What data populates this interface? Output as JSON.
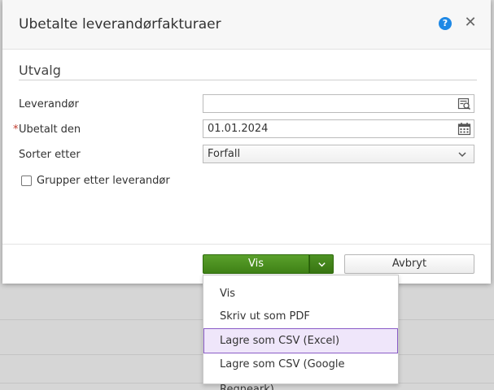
{
  "dialog": {
    "title": "Ubetalte leverandørfakturaer",
    "help_icon": "question-circle-icon",
    "close_glyph": "✕"
  },
  "section": {
    "title": "Utvalg"
  },
  "fields": {
    "supplier": {
      "label": "Leverandør",
      "value": "",
      "icon": "search-list-icon"
    },
    "paid_on": {
      "required_mark": "*",
      "label": "Ubetalt den",
      "value": "01.01.2024",
      "icon": "calendar-icon"
    },
    "sort_by": {
      "label": "Sorter etter",
      "value": "Forfall",
      "icon": "chevron-down-icon"
    },
    "group_by_supplier": {
      "label": "Grupper etter leverandør",
      "checked": false
    }
  },
  "buttons": {
    "show": "Vis",
    "cancel": "Avbryt"
  },
  "menu": {
    "items": [
      {
        "label": "Vis"
      },
      {
        "label": "Skriv ut som PDF"
      },
      {
        "label": "Lagre som CSV (Excel)"
      },
      {
        "label": "Lagre som CSV (Google Regneark)"
      }
    ],
    "active_index": 2
  },
  "colors": {
    "primary_green": "#4a8f1f",
    "menu_highlight": "#efe6fa",
    "menu_highlight_border": "#8a5cc7",
    "required": "#c0392b",
    "help_blue": "#1e88e5"
  }
}
